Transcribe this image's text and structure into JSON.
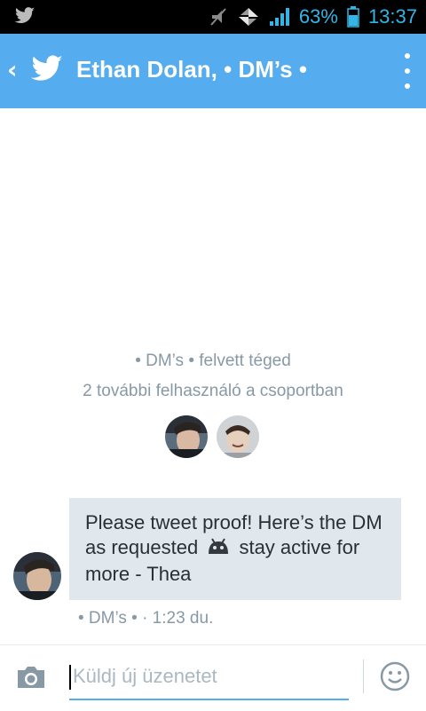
{
  "status_bar": {
    "battery": "63%",
    "time": "13:37",
    "icons": [
      "twitter-icon",
      "mute-icon",
      "data-arrows-icon",
      "signal-icon",
      "battery-icon"
    ]
  },
  "header": {
    "back": "‹",
    "title": "Ethan Dolan, • DM’s •",
    "icons": [
      "back-arrow-icon",
      "twitter-bird-icon",
      "overflow-menu-icon"
    ],
    "color": "#55acee"
  },
  "conversation": {
    "added_line": "• DM’s • felvett téged",
    "members_line": "2 további felhasználó a csoportban",
    "participants": [
      "participant-avatar-1",
      "participant-avatar-2"
    ]
  },
  "message": {
    "text_part1": "Please tweet proof! Here’s the DM as requested",
    "text_part2": "stay active for more - Thea",
    "emoji": "android-emoji-icon",
    "meta": "• DM’s • · 1:23 du."
  },
  "compose": {
    "placeholder": "Küldj új üzenetet",
    "icons": [
      "camera-icon",
      "smiley-icon"
    ]
  }
}
